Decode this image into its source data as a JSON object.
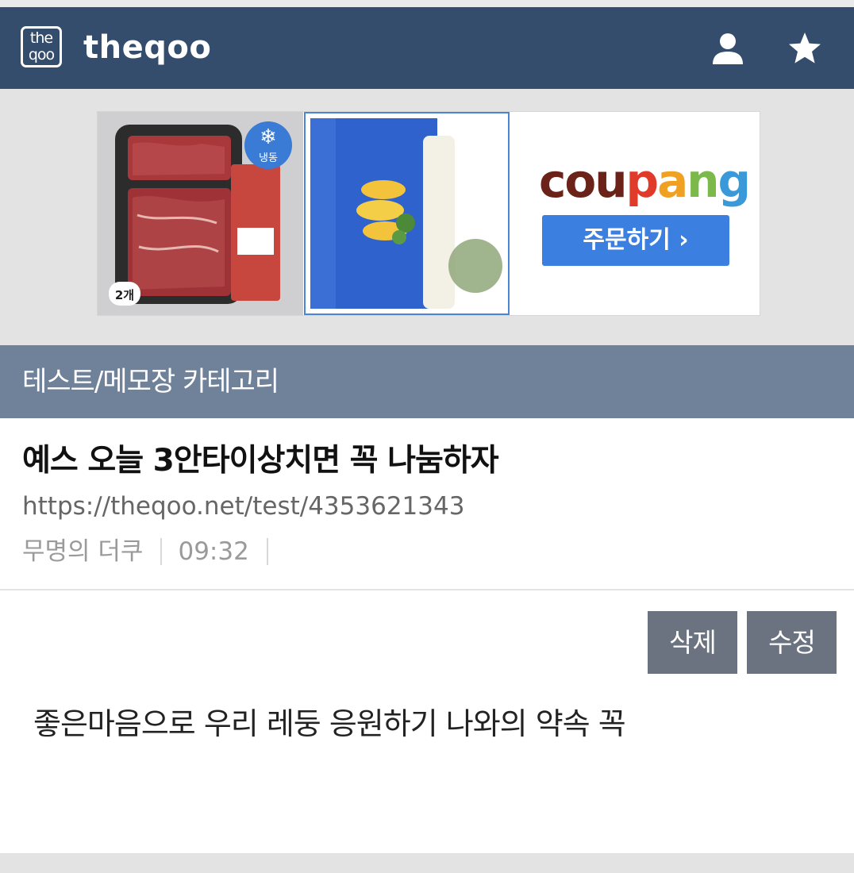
{
  "header": {
    "logo_top": "the",
    "logo_bottom": "qoo",
    "brand": "theqoo"
  },
  "ad": {
    "freeze_badge": "냉동",
    "count_badge": "2개",
    "coupang_letters": [
      {
        "ch": "c",
        "color": "#6b2218"
      },
      {
        "ch": "o",
        "color": "#6b2218"
      },
      {
        "ch": "u",
        "color": "#6b2218"
      },
      {
        "ch": "p",
        "color": "#e03a2a"
      },
      {
        "ch": "a",
        "color": "#f0a122"
      },
      {
        "ch": "n",
        "color": "#7bb94a"
      },
      {
        "ch": "g",
        "color": "#3a9ad9"
      }
    ],
    "order_label": "주문하기 ›"
  },
  "category": "테스트/메모장 카테고리",
  "post": {
    "title": "예스 오늘 3안타이상치면 꼭 나눔하자",
    "url": "https://theqoo.net/test/4353621343",
    "author": "무명의 더쿠",
    "time": "09:32",
    "delete_label": "삭제",
    "edit_label": "수정",
    "body": "좋은마음으로 우리 레둥 응원하기 나와의 약속 꼭"
  },
  "colors": {
    "header_bg": "#344d6d",
    "category_bg": "#70819a",
    "button_bg": "#6b7280",
    "coupang_button": "#3b7fe0"
  }
}
